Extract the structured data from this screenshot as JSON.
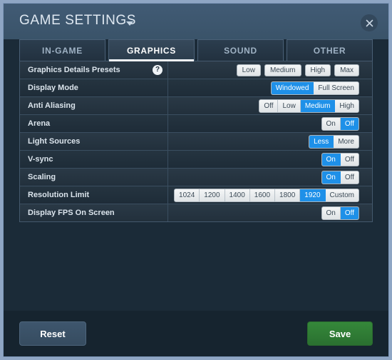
{
  "window": {
    "title": "GAME SETTINGS",
    "close_icon": "close-icon",
    "title_caret_icon": "chevron-down-icon"
  },
  "tabs": [
    {
      "label": "IN-GAME",
      "active": false
    },
    {
      "label": "GRAPHICS",
      "active": true
    },
    {
      "label": "SOUND",
      "active": false
    },
    {
      "label": "OTHER",
      "active": false
    }
  ],
  "settings": [
    {
      "label": "Graphics Details Presets",
      "help_icon": "question-mark-icon",
      "help_label": "?",
      "style": "separate",
      "options": [
        {
          "label": "Low",
          "selected": false
        },
        {
          "label": "Medium",
          "selected": false
        },
        {
          "label": "High",
          "selected": false
        },
        {
          "label": "Max",
          "selected": false
        }
      ]
    },
    {
      "label": "Display Mode",
      "style": "joined",
      "options": [
        {
          "label": "Windowed",
          "selected": true
        },
        {
          "label": "Full Screen",
          "selected": false
        }
      ]
    },
    {
      "label": "Anti Aliasing",
      "style": "joined",
      "options": [
        {
          "label": "Off",
          "selected": false
        },
        {
          "label": "Low",
          "selected": false
        },
        {
          "label": "Medium",
          "selected": true
        },
        {
          "label": "High",
          "selected": false
        }
      ]
    },
    {
      "label": "Arena",
      "style": "joined",
      "options": [
        {
          "label": "On",
          "selected": false
        },
        {
          "label": "Off",
          "selected": true
        }
      ]
    },
    {
      "label": "Light Sources",
      "style": "joined",
      "options": [
        {
          "label": "Less",
          "selected": true
        },
        {
          "label": "More",
          "selected": false
        }
      ]
    },
    {
      "label": "V-sync",
      "style": "joined",
      "options": [
        {
          "label": "On",
          "selected": true
        },
        {
          "label": "Off",
          "selected": false
        }
      ]
    },
    {
      "label": "Scaling",
      "style": "joined",
      "options": [
        {
          "label": "On",
          "selected": true
        },
        {
          "label": "Off",
          "selected": false
        }
      ]
    },
    {
      "label": "Resolution Limit",
      "style": "joined",
      "options": [
        {
          "label": "1024",
          "selected": false
        },
        {
          "label": "1200",
          "selected": false
        },
        {
          "label": "1400",
          "selected": false
        },
        {
          "label": "1600",
          "selected": false
        },
        {
          "label": "1800",
          "selected": false
        },
        {
          "label": "1920",
          "selected": true
        },
        {
          "label": "Custom",
          "selected": false
        }
      ]
    },
    {
      "label": "Display FPS On Screen",
      "style": "joined",
      "options": [
        {
          "label": "On",
          "selected": false
        },
        {
          "label": "Off",
          "selected": true
        }
      ]
    }
  ],
  "footer": {
    "reset_label": "Reset",
    "save_label": "Save"
  },
  "colors": {
    "accent_blue": "#1e90e8",
    "save_green": "#2e7d32",
    "header_blue": "#3d5770",
    "panel_dark": "#1b2b38",
    "border_light": "#7e99bb"
  }
}
